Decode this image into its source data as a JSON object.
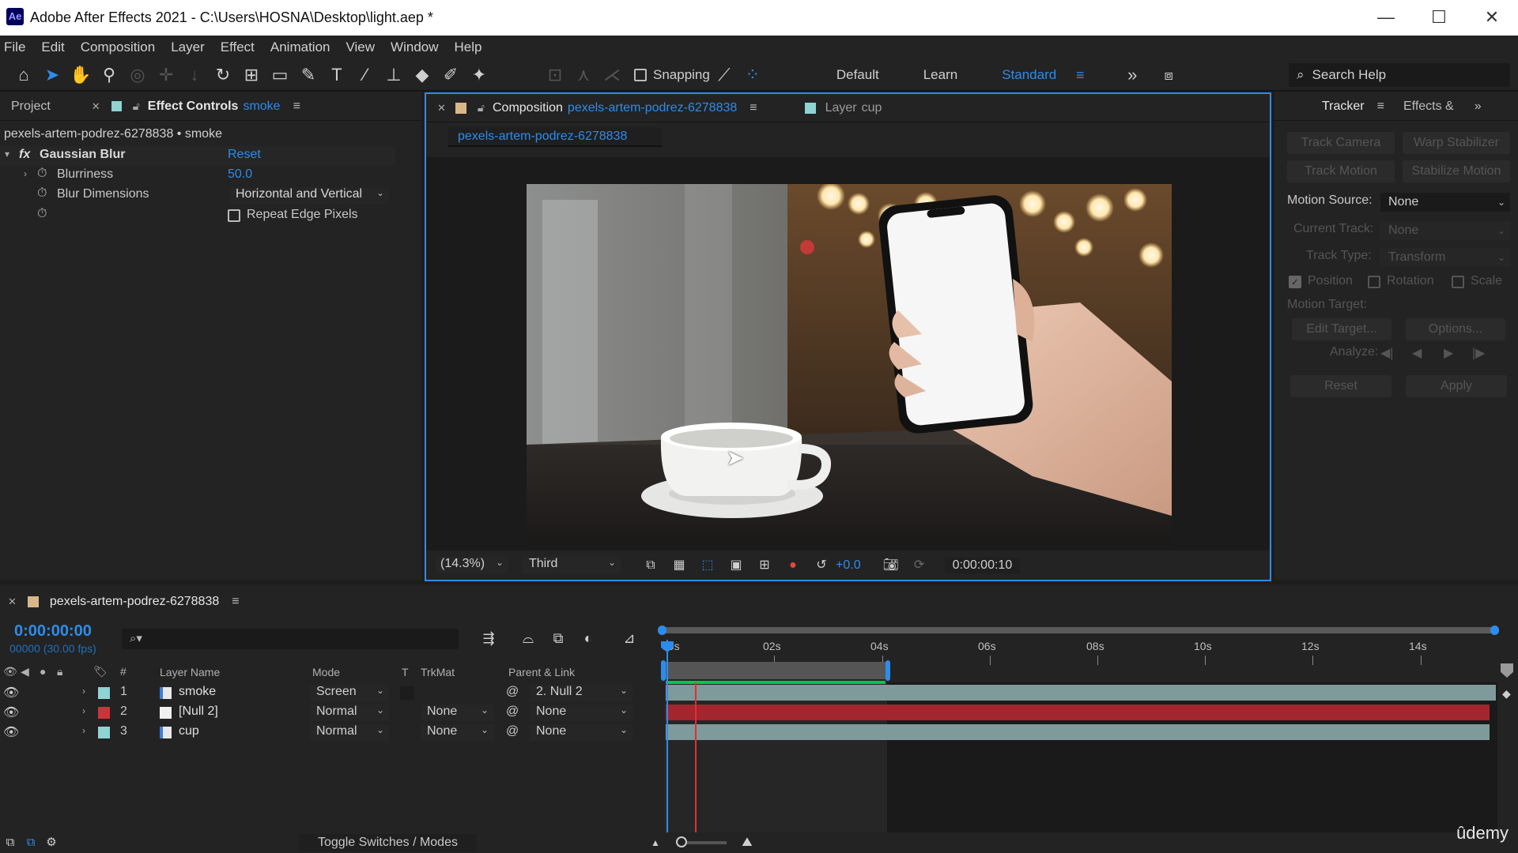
{
  "window": {
    "app_icon": "Ae",
    "title": "Adobe After Effects 2021 - C:\\Users\\HOSNA\\Desktop\\light.aep *",
    "minimize": "—",
    "maximize": "☐",
    "close": "✕"
  },
  "menu": [
    "File",
    "Edit",
    "Composition",
    "Layer",
    "Effect",
    "Animation",
    "View",
    "Window",
    "Help"
  ],
  "toolbar": {
    "snapping_label": "Snapping",
    "workspaces": [
      "Default",
      "Learn",
      "Standard"
    ],
    "active_workspace": "Standard",
    "search_help": "Search Help"
  },
  "effect_panel": {
    "tab_project": "Project",
    "tab_effect_controls": "Effect Controls",
    "tab_effect_layer": "smoke",
    "breadcrumb": "pexels-artem-podrez-6278838 • smoke",
    "effect_name": "Gaussian Blur",
    "reset_label": "Reset",
    "blurriness_label": "Blurriness",
    "blurriness_value": "50.0",
    "dimensions_label": "Blur Dimensions",
    "dimensions_value": "Horizontal and Vertical",
    "repeat_label": "Repeat Edge Pixels"
  },
  "composition": {
    "tab_label": "Composition",
    "comp_name": "pexels-artem-podrez-6278838",
    "layer_tab_label": "Layer",
    "layer_tab_name": "cup",
    "sub_tab": "pexels-artem-podrez-6278838",
    "zoom": "(14.3%)",
    "resolution": "Third",
    "exposure": "+0.0",
    "timecode": "0:00:00:10"
  },
  "tracker": {
    "tab_tracker": "Tracker",
    "tab_effects": "Effects &",
    "track_camera": "Track Camera",
    "warp_stabilizer": "Warp Stabilizer",
    "track_motion": "Track Motion",
    "stabilize_motion": "Stabilize Motion",
    "motion_source_label": "Motion Source:",
    "motion_source_value": "None",
    "current_track_label": "Current Track:",
    "current_track_value": "None",
    "track_type_label": "Track Type:",
    "track_type_value": "Transform",
    "position_label": "Position",
    "rotation_label": "Rotation",
    "scale_label": "Scale",
    "motion_target_label": "Motion Target:",
    "edit_target": "Edit Target...",
    "options": "Options...",
    "analyze_label": "Analyze:",
    "reset": "Reset",
    "apply": "Apply"
  },
  "timeline": {
    "comp_name": "pexels-artem-podrez-6278838",
    "timecode": "0:00:00:00",
    "frame_info": "00000 (30.00 fps)",
    "search_glyph": "⌕▾",
    "col_hash": "#",
    "col_layer_name": "Layer Name",
    "col_mode": "Mode",
    "col_t": "T",
    "col_trkmat": "TrkMat",
    "col_parent": "Parent & Link",
    "ruler": [
      "00s",
      "02s",
      "04s",
      "06s",
      "08s",
      "10s",
      "12s",
      "14s"
    ],
    "toggle_label": "Toggle Switches / Modes",
    "layers": [
      {
        "num": "1",
        "name": "smoke",
        "mode": "Screen",
        "trkmat": "",
        "parent": "2. Null 2",
        "label_color": "#8fd3d3"
      },
      {
        "num": "2",
        "name": "[Null 2]",
        "mode": "Normal",
        "trkmat": "None",
        "parent": "None",
        "label_color": "#c8363a"
      },
      {
        "num": "3",
        "name": "cup",
        "mode": "Normal",
        "trkmat": "None",
        "parent": "None",
        "label_color": "#8fd3d3"
      }
    ]
  },
  "watermark": "ûdemy",
  "colors": {
    "accent": "#2d8ceb",
    "null_bar": "#a3252e",
    "layer_bar": "#7f9a9a",
    "work_area": "#00c853",
    "playhead_red": "#e03030"
  }
}
